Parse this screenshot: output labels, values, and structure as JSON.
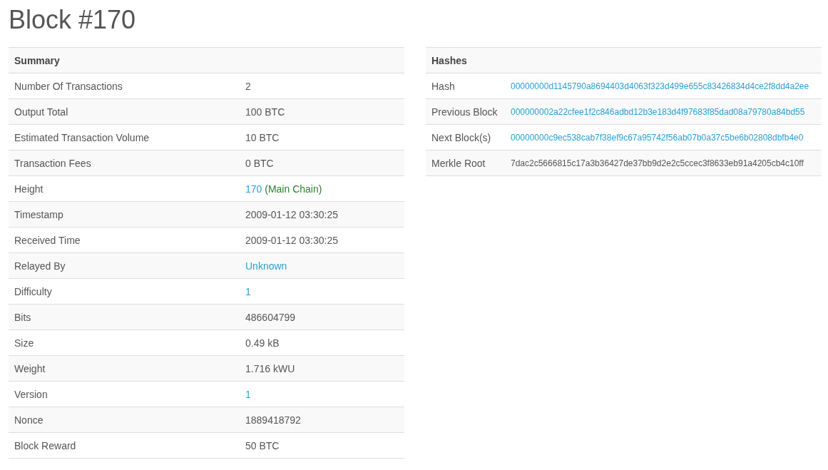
{
  "title": "Block #170",
  "summary": {
    "heading": "Summary",
    "rows": [
      {
        "label": "Number Of Transactions",
        "value": "2",
        "kind": "text"
      },
      {
        "label": "Output Total",
        "value": "100 BTC",
        "kind": "text"
      },
      {
        "label": "Estimated Transaction Volume",
        "value": "10 BTC",
        "kind": "text"
      },
      {
        "label": "Transaction Fees",
        "value": "0 BTC",
        "kind": "text"
      },
      {
        "label": "Height",
        "value": "170",
        "kind": "link",
        "note": "(Main Chain)"
      },
      {
        "label": "Timestamp",
        "value": "2009-01-12 03:30:25",
        "kind": "text"
      },
      {
        "label": "Received Time",
        "value": "2009-01-12 03:30:25",
        "kind": "text"
      },
      {
        "label": "Relayed By",
        "value": "Unknown",
        "kind": "link"
      },
      {
        "label": "Difficulty",
        "value": "1",
        "kind": "link"
      },
      {
        "label": "Bits",
        "value": "486604799",
        "kind": "text"
      },
      {
        "label": "Size",
        "value": "0.49 kB",
        "kind": "text"
      },
      {
        "label": "Weight",
        "value": "1.716 kWU",
        "kind": "text"
      },
      {
        "label": "Version",
        "value": "1",
        "kind": "link"
      },
      {
        "label": "Nonce",
        "value": "1889418792",
        "kind": "text"
      },
      {
        "label": "Block Reward",
        "value": "50 BTC",
        "kind": "text"
      }
    ]
  },
  "hashes": {
    "heading": "Hashes",
    "rows": [
      {
        "label": "Hash",
        "value": "00000000d1145790a8694403d4063f323d499e655c83426834d4ce2f8dd4a2ee",
        "kind": "link"
      },
      {
        "label": "Previous Block",
        "value": "000000002a22cfee1f2c846adbd12b3e183d4f97683f85dad08a79780a84bd55",
        "kind": "link"
      },
      {
        "label": "Next Block(s)",
        "value": "00000000c9ec538cab7f38ef9c67a95742f56ab07b0a37c5be6b02808dbfb4e0",
        "kind": "link"
      },
      {
        "label": "Merkle Root",
        "value": "7dac2c5666815c17a3b36427de37bb9d2e2c5ccec3f8633eb91a4205cb4c10ff",
        "kind": "text"
      }
    ]
  }
}
